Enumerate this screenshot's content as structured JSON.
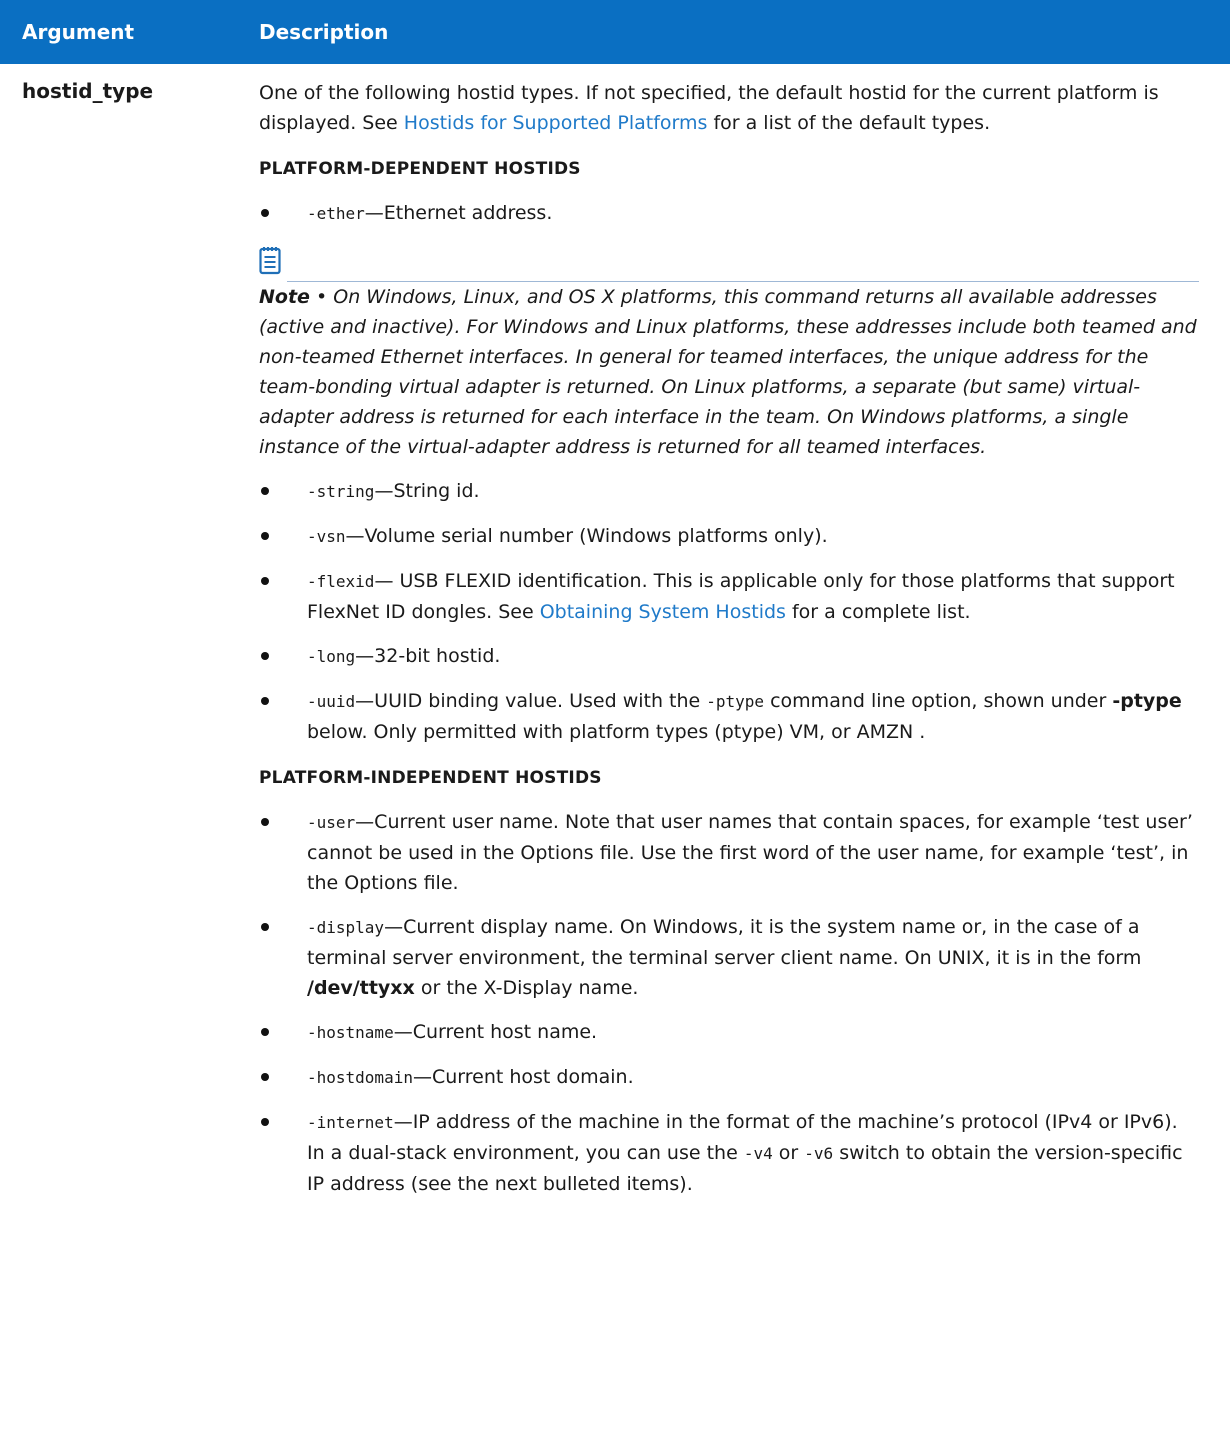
{
  "header": {
    "col1": "Argument",
    "col2": "Description"
  },
  "arg": {
    "name": "hostid_type"
  },
  "intro": {
    "pre": "One of the following hostid types. If not specified, the default hostid for the current platform is displayed. See ",
    "link": "Hostids for Supported Platforms",
    "post": " for a list of the default types."
  },
  "sections": {
    "dependent": "PLATFORM-DEPENDENT HOSTIDS",
    "independent": "PLATFORM-INDEPENDENT HOSTIDS"
  },
  "ether": {
    "code": "-ether",
    "text": "—Ethernet address."
  },
  "note": {
    "label": "Note",
    "sep": " • ",
    "text": "On Windows, Linux, and OS X platforms, this command returns all available addresses (active and inactive). For Windows and Linux platforms, these addresses include both teamed and non-teamed Ethernet interfaces. In general for teamed interfaces, the unique address for the team-bonding virtual adapter is returned. On Linux platforms, a separate (but same) virtual-adapter address is returned for each interface in the team. On Windows platforms, a single instance of the virtual-adapter address is returned for all teamed interfaces."
  },
  "dep_items": {
    "string": {
      "code": "-string",
      "text": "—String id."
    },
    "vsn": {
      "code": "-vsn",
      "text": "—Volume serial number (Windows platforms only)."
    },
    "flexid": {
      "code": "-flexid",
      "pre": "— USB FLEXID identification. This is applicable only for those platforms that support FlexNet ID dongles. See ",
      "link": "Obtaining System Hostids",
      "post": " for a complete list."
    },
    "long": {
      "code": "-long",
      "text": "—32-bit hostid."
    },
    "uuid": {
      "code": "-uuid",
      "t1": "—UUID binding value. Used with the ",
      "code2": "-ptype",
      "t2": " command line option, shown under ",
      "bold": "-ptype",
      "t3": " below. Only permitted with platform types (ptype) VM,  or AMZN ."
    }
  },
  "ind_items": {
    "user": {
      "code": "-user",
      "text": "—Current user name. Note that user names that contain spaces, for example ‘test user’ cannot be used in the Options file. Use the first word of the user name, for example ‘test’, in the Options file."
    },
    "display": {
      "code": "-display",
      "text": "—Current display name. On Windows, it is the system name or, in the case of a terminal server environment, the terminal server client name. On UNIX, it is in the form",
      "bold": "/dev/ttyxx",
      "post": " or the X-Display name."
    },
    "hostname": {
      "code": "-hostname",
      "text": "—Current host name."
    },
    "hostdomain": {
      "code": "-hostdomain",
      "text": "—Current host domain."
    },
    "internet": {
      "code": "-internet",
      "t1": "—IP address of the machine in the format of the machine’s protocol (IPv4 or IPv6). In a dual-stack environment, you can use the ",
      "code2": "-v4",
      "t2": " or ",
      "code3": "-v6",
      "t3": " switch to obtain the version-specific IP address (see the next bulleted items)."
    }
  }
}
